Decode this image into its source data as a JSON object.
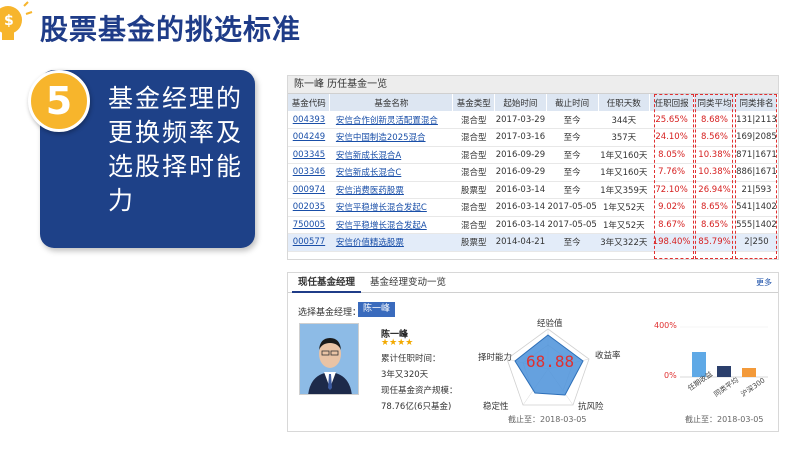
{
  "slide": {
    "title": "股票基金的挑选标准",
    "step_number": "5",
    "card_text": "基金经理的更换频率及选股择时能力"
  },
  "history": {
    "title": "陈一峰 历任基金一览",
    "headers": [
      "基金代码",
      "基金名称",
      "基金类型",
      "起始时间",
      "截止时间",
      "任职天数",
      "任职回报",
      "同类平均",
      "同类排名"
    ],
    "rows": [
      {
        "code": "004393",
        "name": "安信合作创新灵活配置混合",
        "type": "混合型",
        "start": "2017-03-29",
        "end": "至今",
        "days": "344天",
        "ret": "25.65%",
        "avg": "8.68%",
        "rank": "131|2113"
      },
      {
        "code": "004249",
        "name": "安信中国制造2025混合",
        "type": "混合型",
        "start": "2017-03-16",
        "end": "至今",
        "days": "357天",
        "ret": "24.10%",
        "avg": "8.56%",
        "rank": "169|2085"
      },
      {
        "code": "003345",
        "name": "安信新成长混合A",
        "type": "混合型",
        "start": "2016-09-29",
        "end": "至今",
        "days": "1年又160天",
        "ret": "8.05%",
        "avg": "10.38%",
        "rank": "871|1671"
      },
      {
        "code": "003346",
        "name": "安信新成长混合C",
        "type": "混合型",
        "start": "2016-09-29",
        "end": "至今",
        "days": "1年又160天",
        "ret": "7.76%",
        "avg": "10.38%",
        "rank": "886|1671"
      },
      {
        "code": "000974",
        "name": "安信消费医药股票",
        "type": "股票型",
        "start": "2016-03-14",
        "end": "至今",
        "days": "1年又359天",
        "ret": "72.10%",
        "avg": "26.94%",
        "rank": "21|593"
      },
      {
        "code": "002035",
        "name": "安信平稳增长混合发起C",
        "type": "混合型",
        "start": "2016-03-14",
        "end": "2017-05-05",
        "days": "1年又52天",
        "ret": "9.02%",
        "avg": "8.65%",
        "rank": "541|1402"
      },
      {
        "code": "750005",
        "name": "安信平稳增长混合发起A",
        "type": "混合型",
        "start": "2016-03-14",
        "end": "2017-05-05",
        "days": "1年又52天",
        "ret": "8.67%",
        "avg": "8.65%",
        "rank": "555|1402"
      },
      {
        "code": "000577",
        "name": "安信价值精选股票",
        "type": "股票型",
        "start": "2014-04-21",
        "end": "至今",
        "days": "3年又322天",
        "ret": "198.40%",
        "avg": "85.79%",
        "rank": "2|250"
      }
    ]
  },
  "manager_panel": {
    "tab_active": "现任基金经理",
    "tab_other": "基金经理变动一览",
    "more": "更多",
    "select_label": "选择基金经理：",
    "selected": "陈一峰",
    "name": "陈一峰",
    "stars": "★★★★",
    "tenure_label": "累计任职时间：",
    "tenure_value": "3年又320天",
    "aum_label": "现任基金资产规模：",
    "aum_value": "78.76亿(6只基金)",
    "radar_score": "68.88",
    "radar_labels": {
      "top": "经验值",
      "right": "收益率",
      "bottom_right": "抗风险",
      "bottom_left": "稳定性",
      "left": "择时能力"
    },
    "radar_date": "截止至：2018-03-05",
    "bar_ticks": [
      "400%",
      "0%"
    ],
    "bar_categories": [
      "任期收益",
      "同类平均",
      "沪深300"
    ],
    "bar_date": "截止至：2018-03-05"
  }
}
